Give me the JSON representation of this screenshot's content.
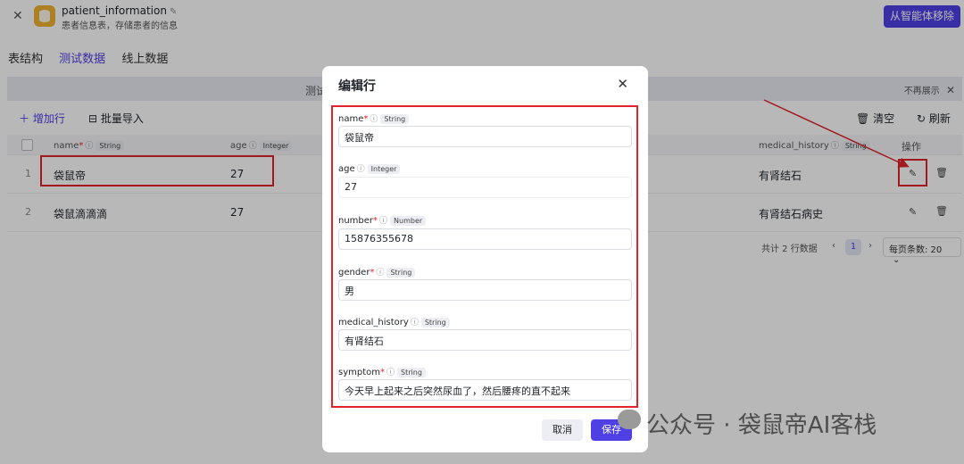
{
  "header": {
    "close": "✕",
    "table_name": "patient_information",
    "edit_icon": "✎",
    "description": "患者信息表，存储患者的信息",
    "remove_button": "从智能体移除"
  },
  "tabs": [
    {
      "label": "表结构",
      "active": false
    },
    {
      "label": "测试数据",
      "active": true
    },
    {
      "label": "线上数据",
      "active": false
    }
  ],
  "banner": {
    "text": "测试",
    "dismiss": "不再展示"
  },
  "toolbar": {
    "add_row": "增加行",
    "bulk_import": "批量导入",
    "clear": "清空",
    "refresh": "刷新"
  },
  "table": {
    "columns": [
      {
        "name": "name",
        "required": true,
        "type": "String"
      },
      {
        "name": "age",
        "required": false,
        "type": "Integer"
      },
      {
        "name": "medical_history",
        "required": false,
        "type": "String"
      }
    ],
    "actions_header": "操作",
    "rows": [
      {
        "index": "1",
        "name": "袋鼠帝",
        "age": "27",
        "medical_history": "有肾结石"
      },
      {
        "index": "2",
        "name": "袋鼠滴滴滴",
        "age": "27",
        "medical_history": "有肾结石病史"
      }
    ]
  },
  "pager": {
    "total": "共计 2 行数据",
    "current_page": "1",
    "page_size": "每页条数: 20"
  },
  "modal": {
    "title": "编辑行",
    "close": "✕",
    "fields": [
      {
        "name": "name",
        "required": true,
        "type": "String",
        "value": "袋鼠帝"
      },
      {
        "name": "age",
        "required": false,
        "type": "Integer",
        "value": "27"
      },
      {
        "name": "number",
        "required": true,
        "type": "Number",
        "value": "15876355678"
      },
      {
        "name": "gender",
        "required": true,
        "type": "String",
        "value": "男"
      },
      {
        "name": "medical_history",
        "required": false,
        "type": "String",
        "value": "有肾结石"
      },
      {
        "name": "symptom",
        "required": true,
        "type": "String",
        "value": "今天早上起来之后突然尿血了，然后腰疼的直不起来"
      }
    ],
    "cancel": "取消",
    "save": "保存"
  },
  "watermark": "公众号 · 袋鼠帝AI客栈",
  "colors": {
    "accent": "#4e40e5",
    "highlight": "#e0232c",
    "banner": "#e8eaf3"
  }
}
